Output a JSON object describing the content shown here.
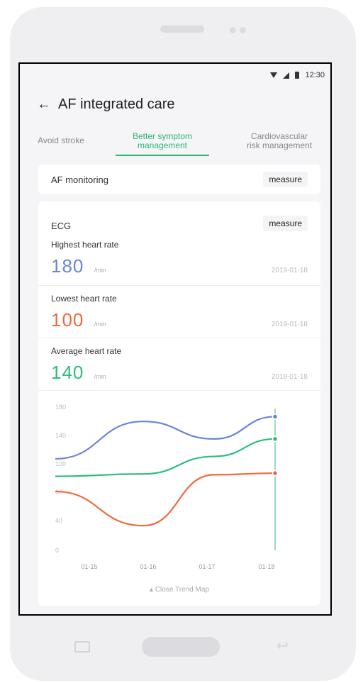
{
  "status": {
    "time": "12:30"
  },
  "header": {
    "back_icon": "arrow-left-icon",
    "title": "AF integrated care"
  },
  "tabs": [
    {
      "label": "Avoid stroke"
    },
    {
      "label": "Better symptom\nmanagement"
    },
    {
      "label": "Cardiovascular\nrisk management"
    }
  ],
  "monitoring": {
    "label": "AF monitoring",
    "button": "measure"
  },
  "ecg": {
    "label": "ECG",
    "button": "measure",
    "metrics": [
      {
        "label": "Highest heart rate",
        "value": "180",
        "unit": "/min",
        "date": "2019-01-18",
        "color": "#6b84d8"
      },
      {
        "label": "Lowest heart rate",
        "value": "100",
        "unit": "/min",
        "date": "2019-01-18",
        "color": "#ef6a3c"
      },
      {
        "label": "Average heart rate",
        "value": "140",
        "unit": "/min",
        "date": "2019-01-18",
        "color": "#2ebd7d"
      }
    ]
  },
  "chart_data": {
    "type": "line",
    "categories": [
      "01-15",
      "01-16",
      "01-17",
      "01-18"
    ],
    "y_ticks": [
      "180",
      "140",
      "100",
      "60",
      "40",
      "0"
    ],
    "ylim": [
      0,
      180
    ],
    "series": [
      {
        "values": [
          115,
          162,
          140,
          168
        ],
        "color": "#6b84d8"
      },
      {
        "values": [
          93,
          96,
          118,
          140
        ],
        "color": "#2ebd7d"
      },
      {
        "values": [
          74,
          31,
          95,
          97
        ],
        "color": "#ef6a3c"
      }
    ],
    "xlabel": "",
    "ylabel": ""
  },
  "trend": {
    "label": "Close Trend Map"
  }
}
